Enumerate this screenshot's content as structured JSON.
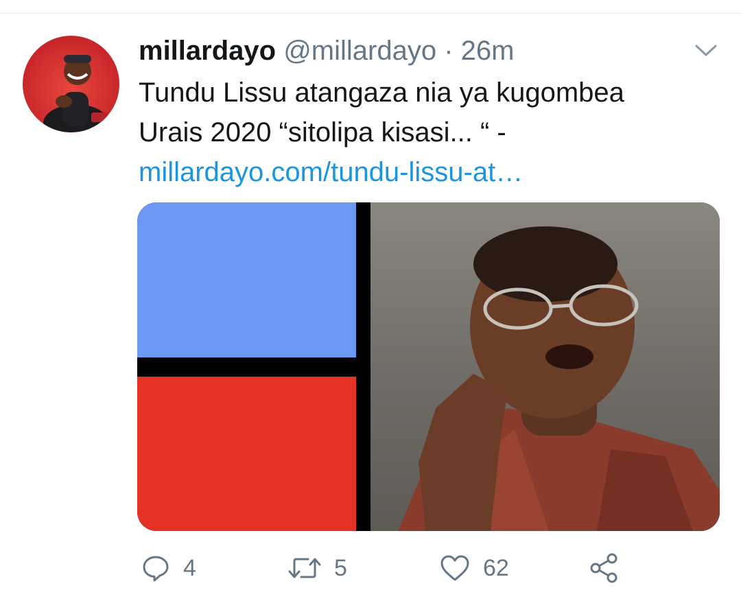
{
  "tweet": {
    "display_name": "millardayo",
    "handle": "@millardayo",
    "separator": "·",
    "time": "26m",
    "text_line_1": "Tundu Lissu atangaza nia ya kugombea",
    "text_line_2": "Urais 2020 “sitolipa kisasi...  “ -",
    "link_text": "millardayo.com/tundu-lissu-at…"
  },
  "actions": {
    "reply_count": "4",
    "retweet_count": "5",
    "like_count": "62"
  },
  "icons": {
    "chevron": "chevron-down-icon",
    "reply": "reply-icon",
    "retweet": "retweet-icon",
    "like": "heart-icon",
    "share": "share-icon"
  },
  "colors": {
    "text": "#14171a",
    "secondary": "#657786",
    "link": "#1b95e0",
    "panel_blue": "#6b98f2",
    "panel_red": "#e63224"
  }
}
